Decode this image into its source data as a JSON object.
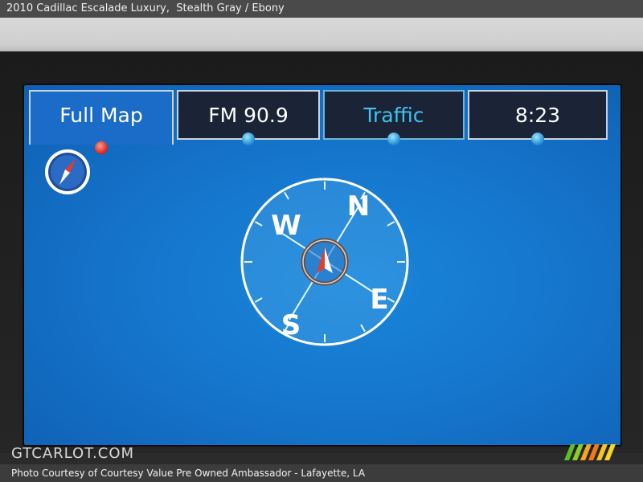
{
  "caption": {
    "vehicle": "2010 Cadillac Escalade Luxury,",
    "colors": "Stealth Gray / Ebony"
  },
  "tabs": [
    {
      "label": "Full Map",
      "active": true
    },
    {
      "label": "FM 90.9",
      "active": false
    },
    {
      "label": "Traffic",
      "active": false
    },
    {
      "label": "8:23",
      "active": false
    }
  ],
  "compass": {
    "north": "N",
    "south": "S",
    "east": "E",
    "west": "W",
    "icon": "compass-icon"
  },
  "footer": {
    "credit": "Photo Courtesy of Courtesy Value Pre Owned Ambassador - Lafayette, LA",
    "watermark": "GTCARLOT.COM"
  },
  "colors": {
    "screen_blue": "#1576cc",
    "active_dot": "#d6201a",
    "inactive_dot": "#1a8ad0",
    "traffic_text": "#3fc2ef"
  }
}
